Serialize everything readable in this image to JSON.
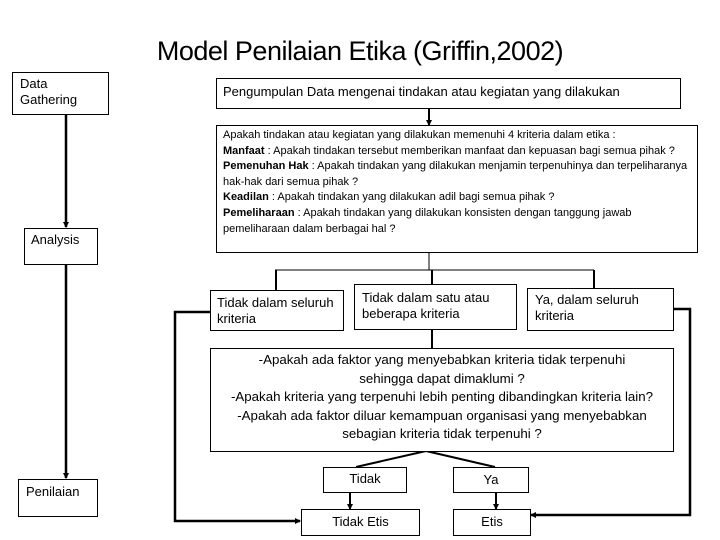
{
  "title": "Model Penilaian Etika (Griffin,2002)",
  "stages": {
    "data_gathering": "Data Gathering",
    "analysis": "Analysis",
    "penilaian": "Penilaian"
  },
  "collection_box": "Pengumpulan Data mengenai tindakan atau kegiatan yang dilakukan",
  "criteria_box": {
    "intro": "Apakah tindakan atau kegiatan yang dilakukan memenuhi 4 kriteria dalam etika :",
    "items": [
      {
        "term": "Manfaat",
        "text": "  : Apakah tindakan tersebut memberikan manfaat dan kepuasan bagi semua pihak ?"
      },
      {
        "term": "Pemenuhan Hak",
        "text": "  : Apakah tindakan yang dilakukan menjamin terpenuhinya dan terpeliharanya hak-hak dari semua pihak ?"
      },
      {
        "term": "Keadilan",
        "text": " : Apakah tindakan yang dilakukan adil bagi semua pihak ?"
      },
      {
        "term": "Pemeliharaan",
        "text": " : Apakah tindakan yang dilakukan konsisten dengan tanggung jawab pemeliharaan dalam berbagai hal ?"
      }
    ]
  },
  "outcomes": {
    "none": "Tidak dalam seluruh kriteria",
    "some": "Tidak dalam satu atau beberapa kriteria",
    "all": "Ya, dalam seluruh kriteria"
  },
  "questions_box": {
    "lines": [
      "-Apakah ada faktor yang menyebabkan kriteria tidak terpenuhi sehingga dapat dimaklumi ?",
      "-Apakah kriteria yang terpenuhi lebih penting dibandingkan kriteria lain?",
      "-Apakah ada faktor diluar kemampuan organisasi yang menyebabkan sebagian kriteria tidak terpenuhi ?"
    ]
  },
  "decisions": {
    "no": "Tidak",
    "yes": "Ya"
  },
  "results": {
    "unethical": "Tidak Etis",
    "ethical": "Etis"
  }
}
